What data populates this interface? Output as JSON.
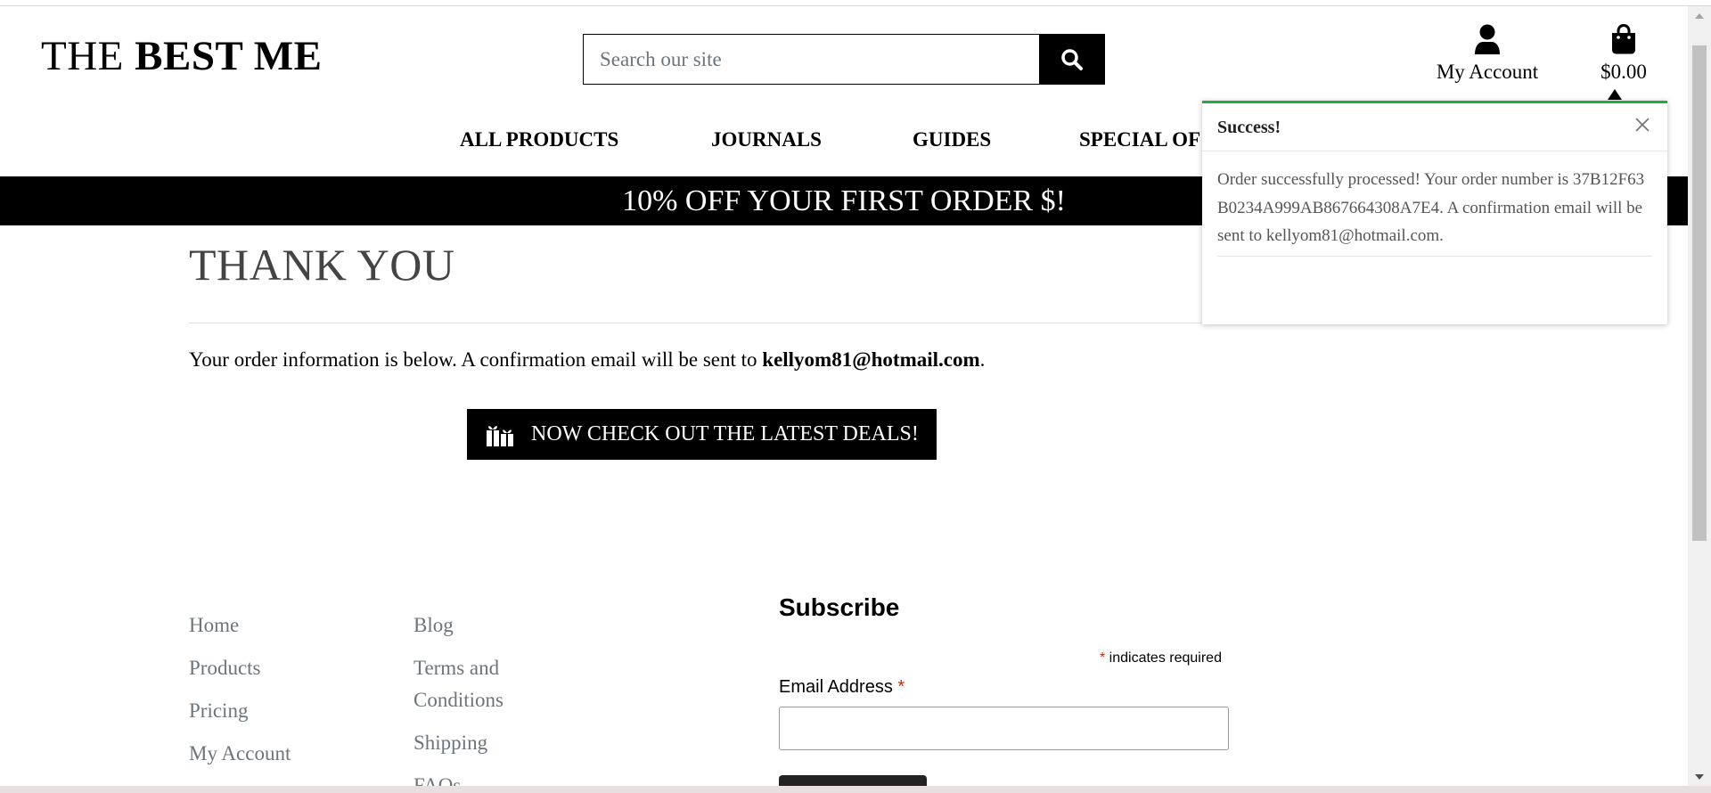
{
  "header": {
    "logo_light": "THE",
    "logo_bold": "BEST ME",
    "search_placeholder": "Search our site",
    "search_icon": "search-icon",
    "account_label": "My Account",
    "account_icon": "user-icon",
    "cart_total": "$0.00",
    "cart_icon": "shopping-bag-icon"
  },
  "nav": {
    "items": [
      {
        "label": "ALL PRODUCTS"
      },
      {
        "label": "JOURNALS"
      },
      {
        "label": "GUIDES"
      },
      {
        "label": "SPECIAL OF"
      }
    ]
  },
  "banner": {
    "text": "10% OFF YOUR FIRST ORDER $!"
  },
  "main": {
    "title": "THANK YOU",
    "info_text": "Your order information is below. A confirmation email will be sent to ",
    "info_email": "kellyom81@hotmail.com",
    "info_end": ".",
    "deals_button": "NOW CHECK OUT THE LATEST DEALS!",
    "deals_icon": "gifts-icon"
  },
  "footer": {
    "col1": [
      {
        "label": "Home"
      },
      {
        "label": "Products"
      },
      {
        "label": "Pricing"
      },
      {
        "label": "My Account"
      }
    ],
    "col2": [
      {
        "label": "Blog"
      },
      {
        "label": "Terms and"
      },
      {
        "label": "Conditions"
      },
      {
        "label": "Shipping"
      },
      {
        "label": "FAQs"
      }
    ],
    "subscribe": {
      "title": "Subscribe",
      "required_star": "*",
      "required_note": " indicates required",
      "email_label": "Email Address ",
      "email_star": "*"
    }
  },
  "toast": {
    "title": "Success!",
    "message": "Order successfully processed! Your order number is 37B12F63B0234A999AB867664308A7E4. A confirmation email will be sent to kellyom81@hotmail.com.",
    "close_icon": "close-icon",
    "accent_color": "#28a745"
  }
}
